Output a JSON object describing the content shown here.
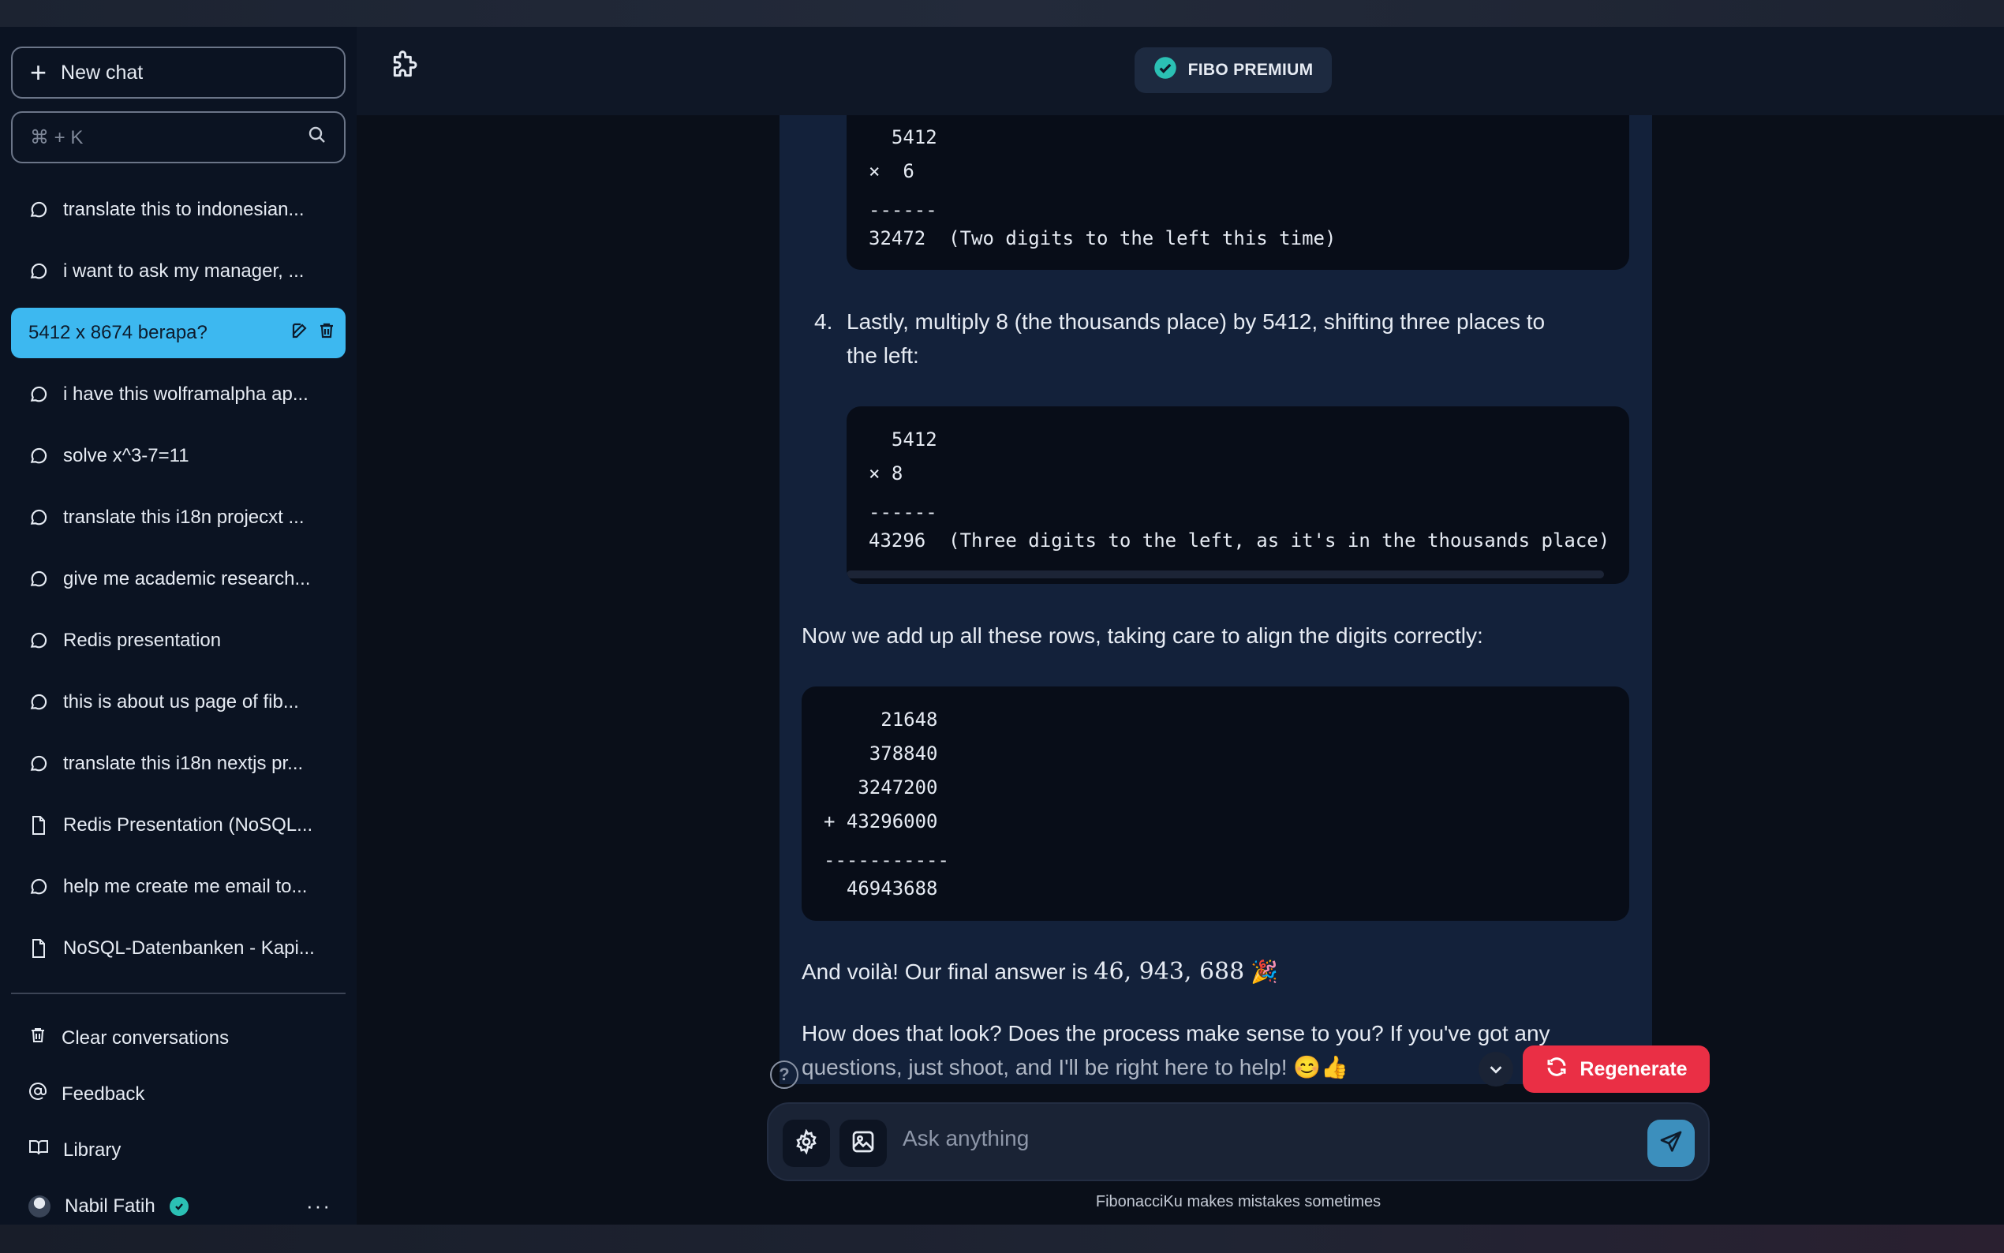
{
  "sidebar": {
    "new_chat_label": "New chat",
    "search_placeholder": "⌘ + K",
    "conversations": [
      {
        "label": "translate this to indonesian...",
        "icon": "chat-bubble-icon"
      },
      {
        "label": "i want to ask my manager, ...",
        "icon": "chat-bubble-icon"
      },
      {
        "label": "5412 x 8674 berapa?",
        "icon": "none",
        "active": true
      },
      {
        "label": "i have this wolframalpha ap...",
        "icon": "chat-bubble-icon"
      },
      {
        "label": "solve x^3-7=11",
        "icon": "chat-bubble-icon"
      },
      {
        "label": "translate this i18n projecxt ...",
        "icon": "chat-bubble-icon"
      },
      {
        "label": "give me academic research...",
        "icon": "chat-bubble-icon"
      },
      {
        "label": "Redis presentation",
        "icon": "chat-bubble-icon"
      },
      {
        "label": "this is about us page of fib...",
        "icon": "chat-bubble-icon"
      },
      {
        "label": "translate this i18n nextjs pr...",
        "icon": "chat-bubble-icon"
      },
      {
        "label": "Redis Presentation (NoSQL...",
        "icon": "document-icon"
      },
      {
        "label": "help me create me email to...",
        "icon": "chat-bubble-icon"
      },
      {
        "label": "NoSQL-Datenbanken - Kapi...",
        "icon": "document-icon"
      }
    ],
    "bottom_menu": {
      "clear": "Clear conversations",
      "feedback": "Feedback",
      "library": "Library"
    },
    "user": {
      "name": "Nabil Fatih",
      "more": "···"
    }
  },
  "header": {
    "premium_label": "FIBO PREMIUM"
  },
  "chat": {
    "block1": {
      "lines": [
        "  5412",
        "×  6",
        "------",
        "32472  (Two digits to the left this time)"
      ]
    },
    "step4": {
      "number": "4.",
      "line1": "Lastly, multiply 8 (the thousands place) by 5412, shifting three places to",
      "line2": "the left:"
    },
    "block2": {
      "lines": [
        "  5412",
        "× 8",
        "------",
        "43296  (Three digits to the left, as it's in the thousands place)"
      ]
    },
    "add_rows_text": "Now we add up all these rows, taking care to align the digits correctly:",
    "block3": {
      "lines": [
        "     21648",
        "    378840",
        "   3247200",
        "+ 43296000",
        "-----------",
        "  46943688"
      ]
    },
    "final_prefix": "And voilà! Our final answer is ",
    "final_value": "46, 943, 688",
    "final_emoji": "🎉",
    "question_line1": "How does that look? Does the process make sense to you? If you've got any",
    "question_line2": "questions, just shoot, and I'll be right here to help! 😊👍"
  },
  "composer": {
    "regenerate_label": "Regenerate",
    "placeholder": "Ask anything",
    "help": "?",
    "disclaimer": "FibonacciKu makes mistakes sometimes"
  },
  "colors": {
    "accent": "#3db8f0",
    "regenerate": "#ea2f45",
    "verified": "#2bc0b4",
    "send": "#3c8fbd"
  }
}
